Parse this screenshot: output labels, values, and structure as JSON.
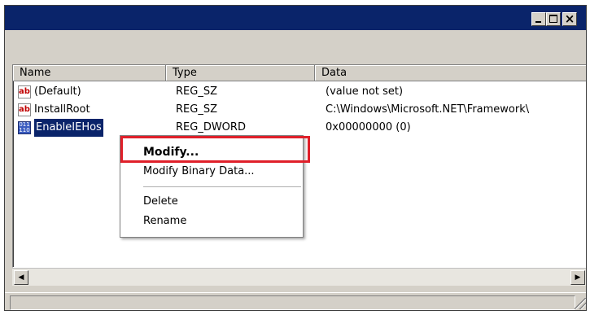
{
  "window": {
    "title": "",
    "buttons": {
      "minimize_icon": "minimize-icon",
      "maximize_icon": "maximize-icon",
      "close_icon": "close-icon",
      "close_glyph": "×"
    }
  },
  "list": {
    "columns": {
      "name": "Name",
      "type": "Type",
      "data": "Data"
    },
    "rows": [
      {
        "icon": "string-value-icon",
        "icon_text": "ab",
        "name": "(Default)",
        "type": "REG_SZ",
        "data": "(value not set)"
      },
      {
        "icon": "string-value-icon",
        "icon_text": "ab",
        "name": "InstallRoot",
        "type": "REG_SZ",
        "data": "C:\\Windows\\Microsoft.NET\\Framework\\"
      },
      {
        "icon": "binary-value-icon",
        "icon_text": "011\n110",
        "name": "EnableIEHos",
        "type": "REG_DWORD",
        "data": "0x00000000 (0)",
        "selected": true
      }
    ]
  },
  "context_menu": {
    "items": [
      {
        "label": "Modify...",
        "bold": true
      },
      {
        "label": "Modify Binary Data..."
      },
      {
        "label": "Delete"
      },
      {
        "label": "Rename"
      }
    ]
  },
  "scrollbar": {
    "left_icon": "scroll-left-icon",
    "right_icon": "scroll-right-icon",
    "left_glyph": "◀",
    "right_glyph": "▶"
  },
  "colors": {
    "title_bar": "#0a246a",
    "selection": "#0a246a",
    "highlight_box": "#e0202a",
    "chrome": "#d4d0c8"
  }
}
